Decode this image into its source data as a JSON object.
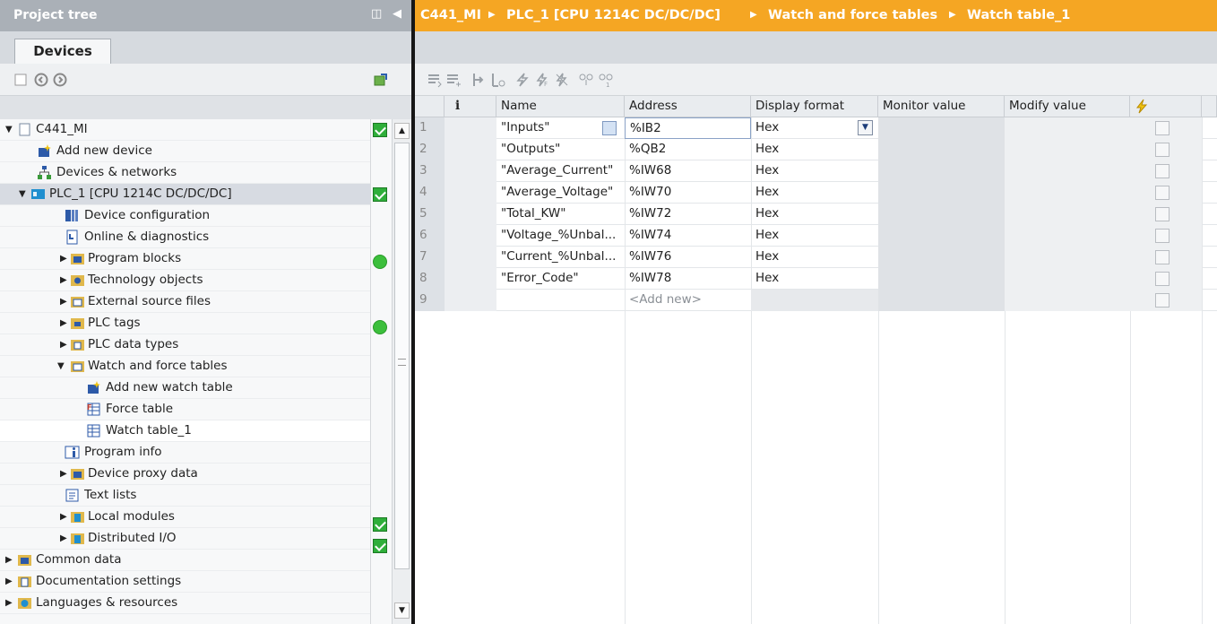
{
  "left": {
    "title": "Project tree",
    "tab": "Devices",
    "tree": [
      {
        "label": "C441_MI",
        "expanded": true,
        "status": "check"
      },
      {
        "label": "Add new device"
      },
      {
        "label": "Devices & networks"
      },
      {
        "label": "PLC_1 [CPU 1214C DC/DC/DC]",
        "expanded": true,
        "status": "check"
      },
      {
        "label": "Device configuration"
      },
      {
        "label": "Online & diagnostics"
      },
      {
        "label": "Program blocks",
        "collapsed": true,
        "status": "dot"
      },
      {
        "label": "Technology objects",
        "collapsed": true
      },
      {
        "label": "External source files",
        "collapsed": true
      },
      {
        "label": "PLC tags",
        "collapsed": true,
        "status": "dot"
      },
      {
        "label": "PLC data types",
        "collapsed": true
      },
      {
        "label": "Watch and force tables",
        "expanded": true
      },
      {
        "label": "Add new watch table"
      },
      {
        "label": "Force table"
      },
      {
        "label": "Watch table_1",
        "selected": true
      },
      {
        "label": "Program info"
      },
      {
        "label": "Device proxy data",
        "collapsed": true
      },
      {
        "label": "Text lists"
      },
      {
        "label": "Local modules",
        "collapsed": true,
        "status": "check"
      },
      {
        "label": "Distributed I/O",
        "collapsed": true,
        "status": "check"
      },
      {
        "label": "Common data",
        "collapsed": true
      },
      {
        "label": "Documentation settings",
        "collapsed": true
      },
      {
        "label": "Languages & resources",
        "collapsed": true
      }
    ]
  },
  "right": {
    "breadcrumb": [
      "C441_MI",
      "PLC_1 [CPU 1214C DC/DC/DC]",
      "Watch and force tables",
      "Watch table_1"
    ],
    "columns": {
      "info": "i",
      "name": "Name",
      "address": "Address",
      "display_format": "Display format",
      "monitor_value": "Monitor value",
      "modify_value": "Modify value"
    },
    "rows": [
      {
        "n": "1",
        "name": "\"Inputs\"",
        "address": "%IB2",
        "format": "Hex"
      },
      {
        "n": "2",
        "name": "\"Outputs\"",
        "address": "%QB2",
        "format": "Hex"
      },
      {
        "n": "3",
        "name": "\"Average_Current\"",
        "address": "%IW68",
        "format": "Hex"
      },
      {
        "n": "4",
        "name": "\"Average_Voltage\"",
        "address": "%IW70",
        "format": "Hex"
      },
      {
        "n": "5",
        "name": "\"Total_KW\"",
        "address": "%IW72",
        "format": "Hex"
      },
      {
        "n": "6",
        "name": "\"Voltage_%Unbal...",
        "address": "%IW74",
        "format": "Hex"
      },
      {
        "n": "7",
        "name": "\"Current_%Unbal...",
        "address": "%IW76",
        "format": "Hex"
      },
      {
        "n": "8",
        "name": "\"Error_Code\"",
        "address": "%IW78",
        "format": "Hex"
      },
      {
        "n": "9",
        "name": "",
        "address": "<Add new>",
        "format": ""
      }
    ]
  },
  "colors": {
    "accent": "#f5a623",
    "check": "#2fae3a",
    "ok_dot": "#3cbf3c"
  }
}
